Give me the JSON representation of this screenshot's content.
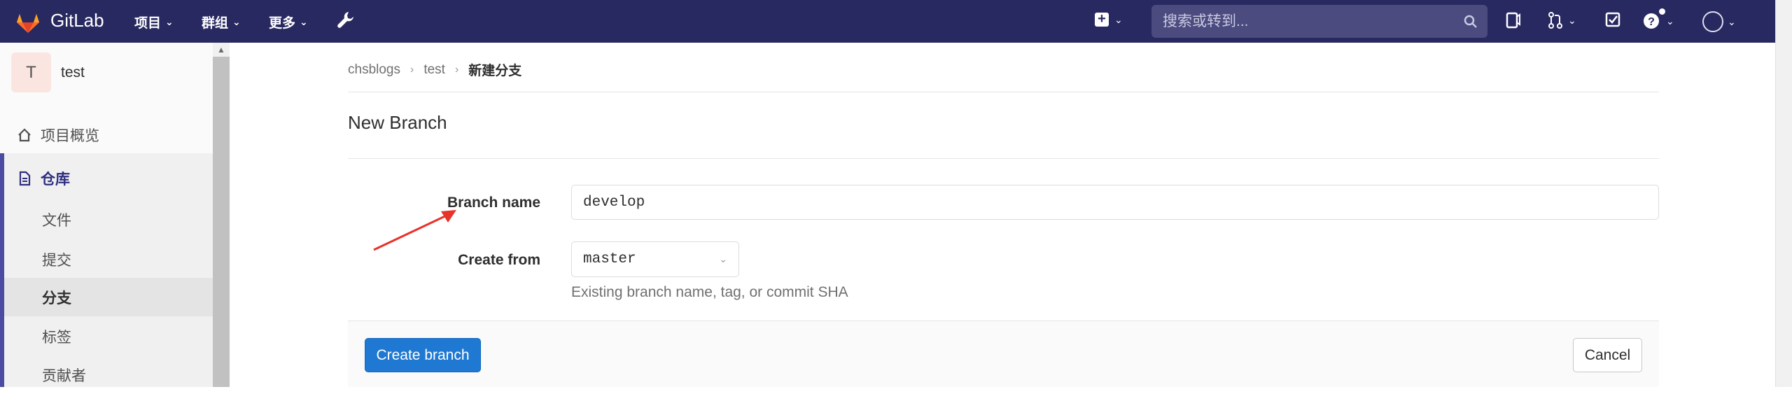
{
  "navbar": {
    "brand": "GitLab",
    "menu": [
      {
        "label": "项目"
      },
      {
        "label": "群组"
      },
      {
        "label": "更多"
      }
    ],
    "search_placeholder": "搜索或转到..."
  },
  "sidebar": {
    "project_initial": "T",
    "project_name": "test",
    "overview": "项目概览",
    "repository": "仓库",
    "sub_items": [
      "文件",
      "提交",
      "分支",
      "标签",
      "贡献者"
    ]
  },
  "breadcrumb": {
    "items": [
      "chsblogs",
      "test"
    ],
    "current": "新建分支"
  },
  "page": {
    "title": "New Branch"
  },
  "form": {
    "branch_name_label": "Branch name",
    "branch_name_value": "develop",
    "create_from_label": "Create from",
    "create_from_value": "master",
    "help_text": "Existing branch name, tag, or commit SHA",
    "submit_label": "Create branch",
    "cancel_label": "Cancel"
  },
  "colors": {
    "navbar_bg": "#292961",
    "primary_button": "#1f78d1",
    "annotation_arrow": "#e8322a"
  }
}
